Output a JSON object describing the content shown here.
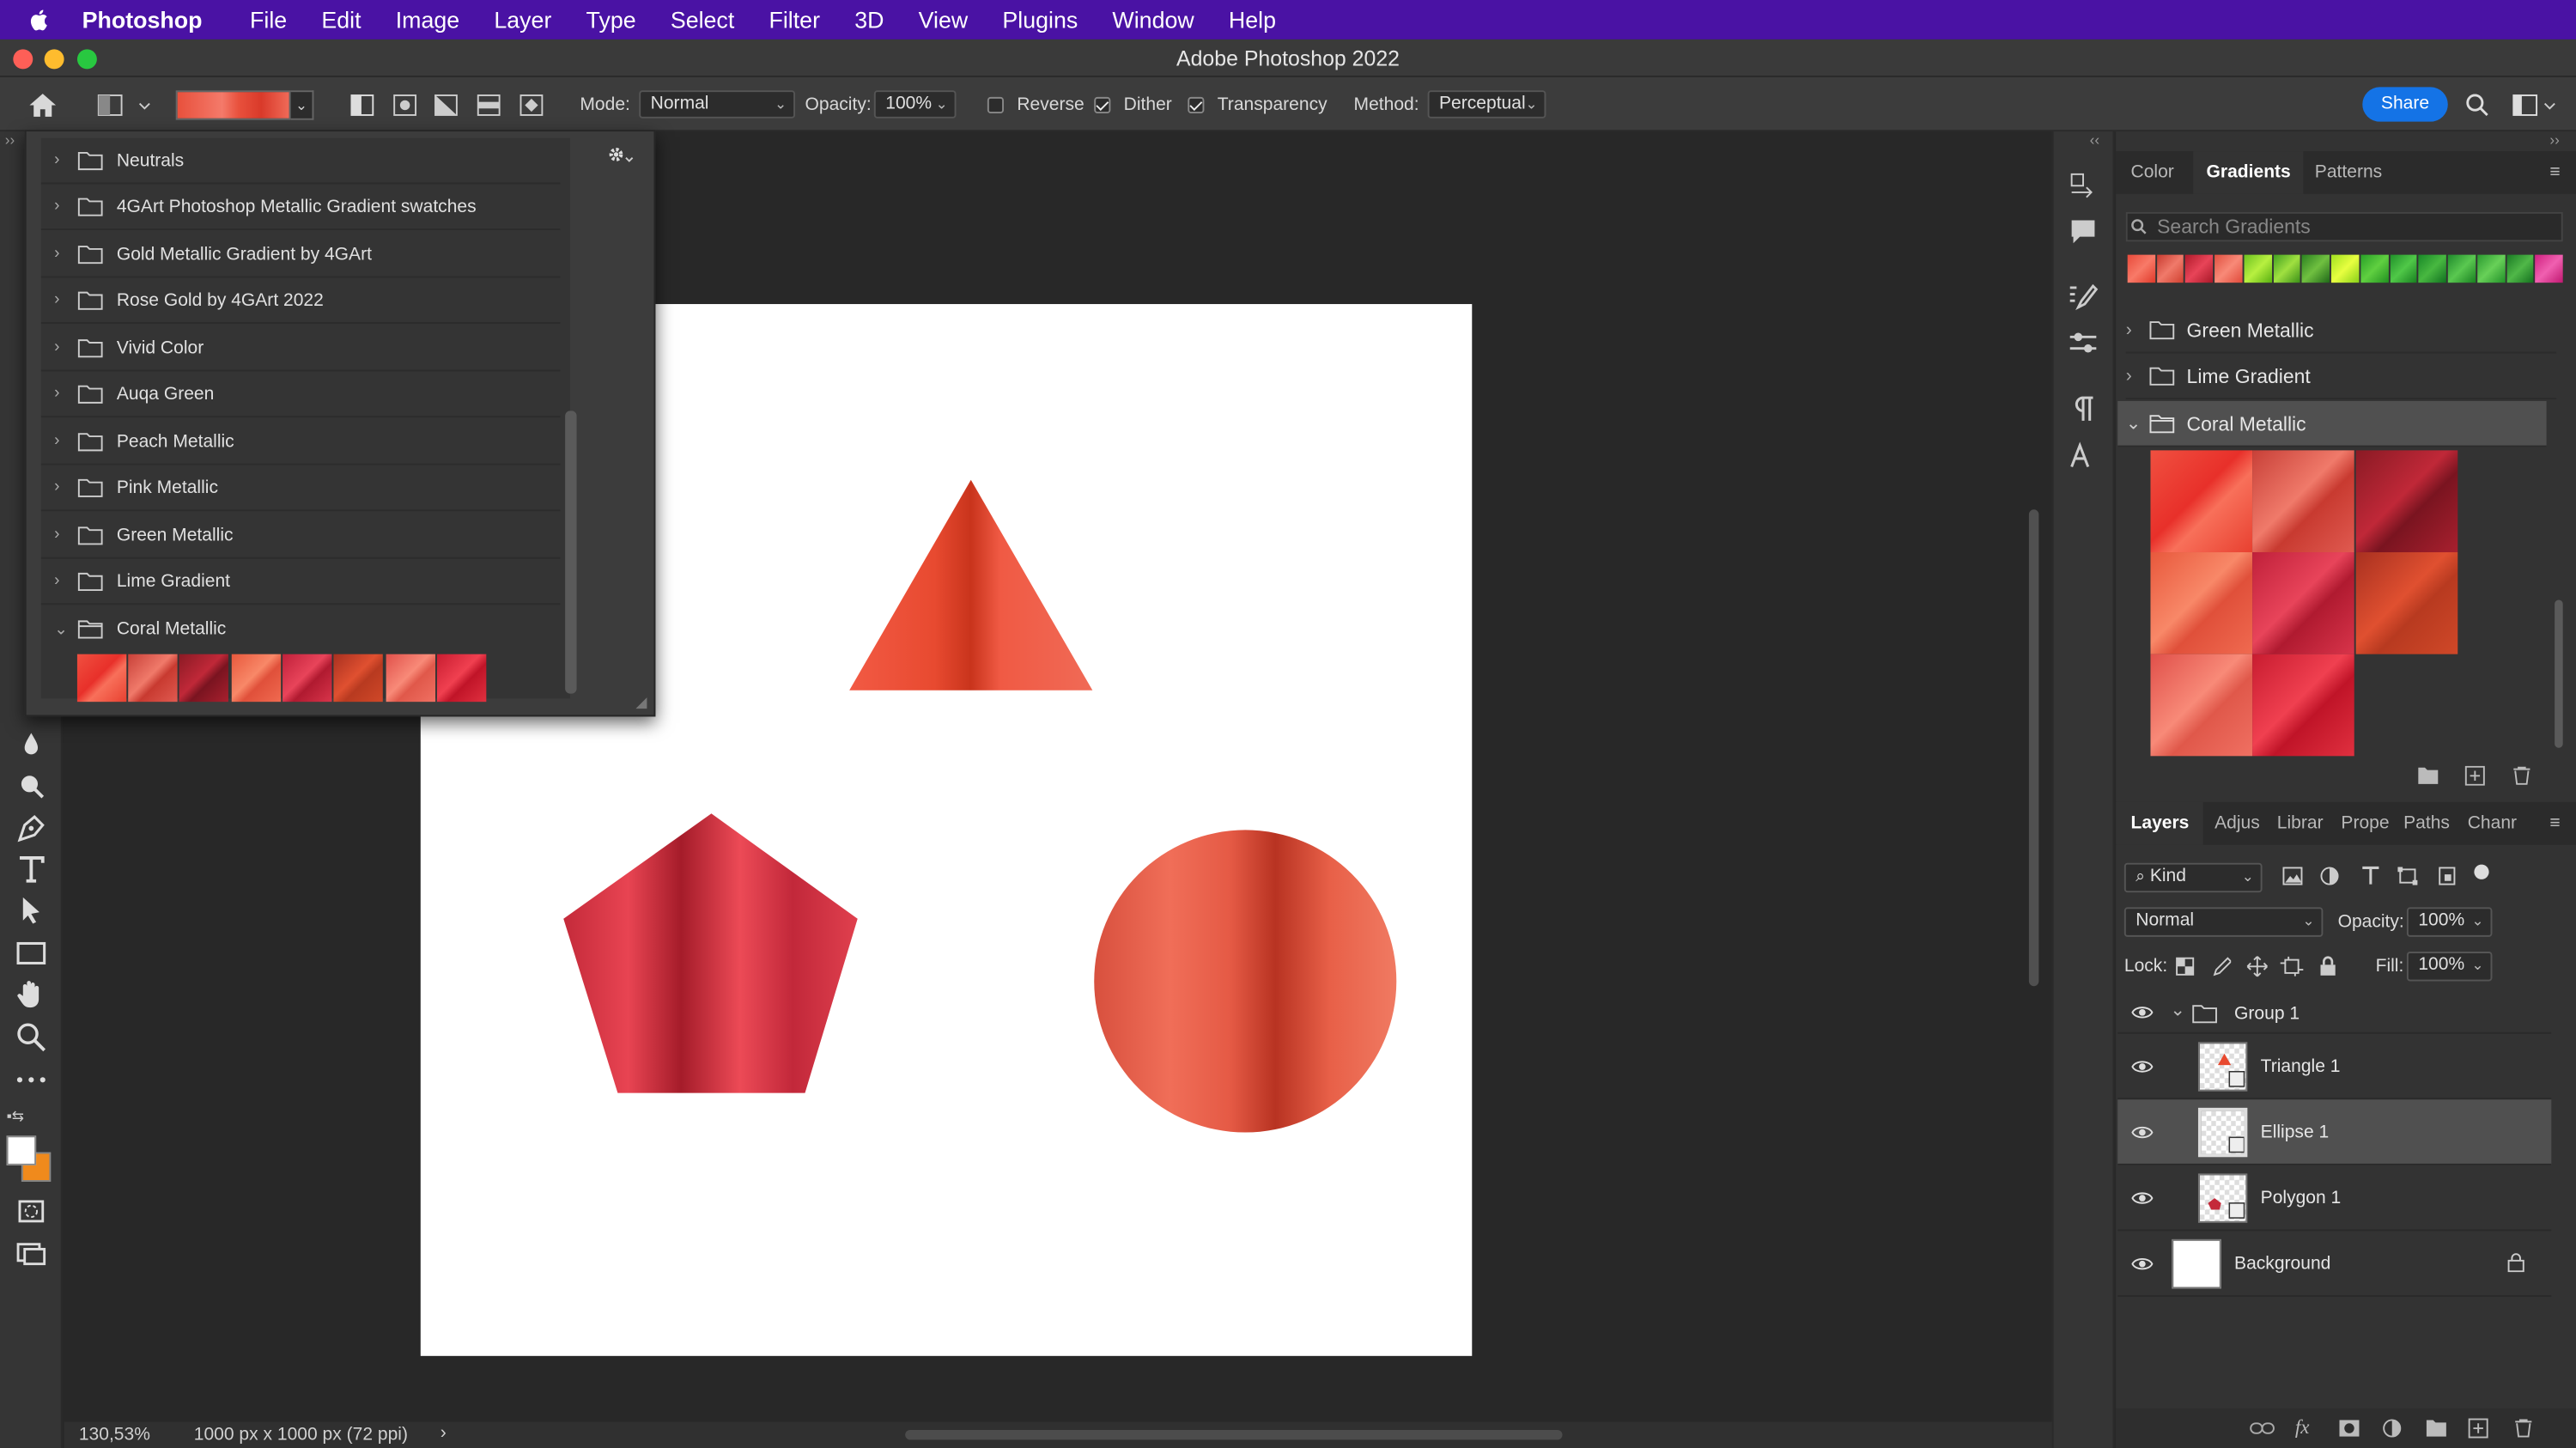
{
  "menubar": {
    "app_name": "Photoshop",
    "items": [
      "File",
      "Edit",
      "Image",
      "Layer",
      "Type",
      "Select",
      "Filter",
      "3D",
      "View",
      "Plugins",
      "Window",
      "Help"
    ]
  },
  "window": {
    "title": "Adobe Photoshop 2022"
  },
  "options_bar": {
    "mode_label": "Mode:",
    "mode_value": "Normal",
    "opacity_label": "Opacity:",
    "opacity_value": "100%",
    "reverse_label": "Reverse",
    "reverse_checked": false,
    "dither_label": "Dither",
    "dither_checked": true,
    "transparency_label": "Transparency",
    "transparency_checked": true,
    "method_label": "Method:",
    "method_value": "Perceptual",
    "share_label": "Share"
  },
  "gradient_picker": {
    "folders": [
      {
        "name": "Neutrals",
        "expanded": false
      },
      {
        "name": "4GArt Photoshop Metallic Gradient swatches",
        "expanded": false
      },
      {
        "name": "Gold Metallic Gradient by 4GArt",
        "expanded": false
      },
      {
        "name": "Rose Gold by 4GArt 2022",
        "expanded": false
      },
      {
        "name": "Vivid Color",
        "expanded": false
      },
      {
        "name": "Auqa Green",
        "expanded": false
      },
      {
        "name": "Peach Metallic",
        "expanded": false
      },
      {
        "name": "Pink Metallic",
        "expanded": false
      },
      {
        "name": "Green Metallic",
        "expanded": false
      },
      {
        "name": "Lime Gradient",
        "expanded": false
      },
      {
        "name": "Coral Metallic",
        "expanded": true
      }
    ],
    "swatch_count": 8
  },
  "gradients_panel": {
    "tabs": [
      "Color",
      "Gradients",
      "Patterns"
    ],
    "active_tab": "Gradients",
    "search_placeholder": "Search Gradients",
    "groups": [
      {
        "name": "Green Metallic",
        "expanded": false
      },
      {
        "name": "Lime Gradient",
        "expanded": false
      },
      {
        "name": "Coral Metallic",
        "expanded": true
      }
    ]
  },
  "layers_panel": {
    "tabs": [
      "Layers",
      "Adjus",
      "Librar",
      "Prope",
      "Paths",
      "Chanr"
    ],
    "active_tab": "Layers",
    "filter_kind": "Kind",
    "blend_mode": "Normal",
    "opacity_label": "Opacity:",
    "opacity_value": "100%",
    "lock_label": "Lock:",
    "fill_label": "Fill:",
    "fill_value": "100%",
    "layers": [
      {
        "name": "Group 1",
        "type": "group"
      },
      {
        "name": "Triangle 1",
        "type": "shape"
      },
      {
        "name": "Ellipse 1",
        "type": "shape",
        "selected": true
      },
      {
        "name": "Polygon 1",
        "type": "shape"
      },
      {
        "name": "Background",
        "type": "background",
        "locked": true
      }
    ]
  },
  "status": {
    "zoom": "130,53%",
    "doc_size": "1000 px x 1000 px (72 ppi)"
  },
  "colors": {
    "menubar": "#4a12a4",
    "accent": "#1473e6",
    "coral": "#e8503c",
    "foreground_swatch": "#ffffff",
    "background_swatch": "#f08a1c"
  }
}
